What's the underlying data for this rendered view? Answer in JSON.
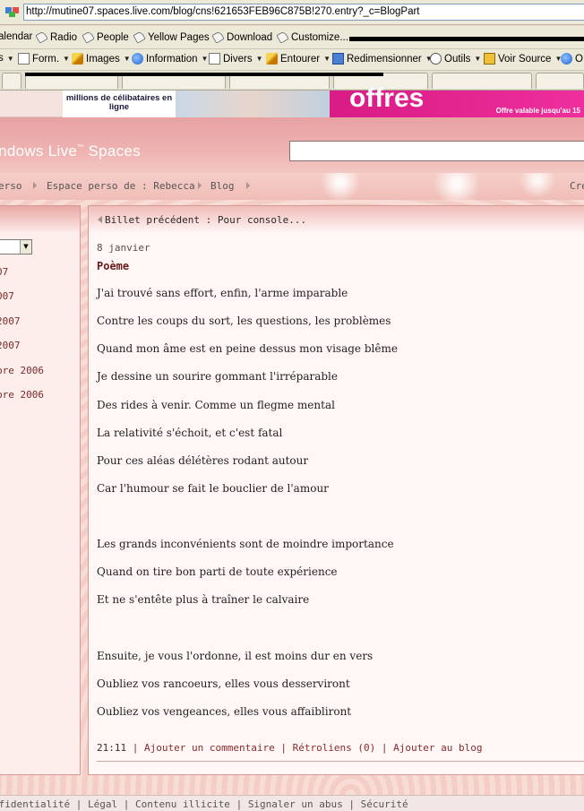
{
  "browser": {
    "url": "http://mutine07.spaces.live.com/blog/cns!621653FEB96C875B!270.entry?_c=BlogPart",
    "links_toolbar": [
      "alendar",
      "Radio",
      "People",
      "Yellow Pages",
      "Download",
      "Customize..."
    ],
    "tools_toolbar": [
      {
        "label": "s",
        "icon": "caret-icon"
      },
      {
        "label": "Form.",
        "icon": "form-icon"
      },
      {
        "label": "Images",
        "icon": "images-icon"
      },
      {
        "label": "Information",
        "icon": "info-icon"
      },
      {
        "label": "Divers",
        "icon": "list-icon"
      },
      {
        "label": "Entourer",
        "icon": "pencil-icon"
      },
      {
        "label": "Redimensionner",
        "icon": "window-icon"
      },
      {
        "label": "Outils",
        "icon": "clock-icon"
      },
      {
        "label": "Voir Source",
        "icon": "source-icon"
      },
      {
        "label": "O",
        "icon": "globe-icon"
      }
    ]
  },
  "ad": {
    "left_text": "millions de célibataires en ligne",
    "right_text": "offres",
    "right_small": "Offre valable jusqu'au 15"
  },
  "site": {
    "brand": "indows Live",
    "brand_tm": "™",
    "brand_suffix": " Spaces"
  },
  "breadcrumb": {
    "items": [
      "erso",
      "Espace perso de : Rebecca",
      "Blog"
    ],
    "right": "Cre"
  },
  "sidebar": {
    "archive": [
      "07",
      "007",
      "2007",
      "2007",
      "bre 2006",
      "bre 2006"
    ]
  },
  "post": {
    "prev_link": "Billet précédent : Pour console...",
    "date": "8 janvier",
    "title": "Poème",
    "lines": [
      "J'ai trouvé sans effort, enfin, l'arme imparable",
      "Contre les coups du sort, les questions, les problèmes",
      "Quand mon âme est en peine dessus mon visage blême",
      "Je dessine un sourire gommant l'irréparable",
      "Des rides à venir. Comme un flegme mental",
      "La relativité s'échoit, et c'est fatal",
      "Pour ces aléas délétères rodant autour",
      "Car l'humour se fait le bouclier de l'amour",
      "",
      "Les grands inconvénients sont de moindre importance",
      "Quand on tire bon parti de toute expérience",
      "Et ne s'entête plus à traîner le calvaire",
      "",
      "Ensuite, je vous l'ordonne, il est moins dur en vers",
      "Oubliez vos rancoeurs, elles vous desserviront",
      "Oubliez vos vengeances, elles vous affaibliront"
    ],
    "time": "21:11",
    "comment": "Ajouter un commentaire",
    "trackbacks": "Rétroliens (0)",
    "add_to_blog": "Ajouter au blog",
    "sep": "|"
  },
  "footer": {
    "links": [
      "nfidentialité",
      "Légal",
      "Contenu illicite",
      "Signaler un abus",
      "Sécurité"
    ],
    "sep": "|"
  }
}
